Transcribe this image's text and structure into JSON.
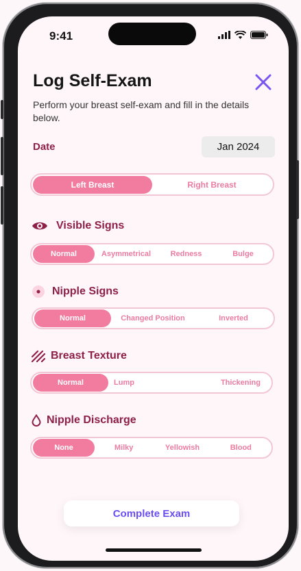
{
  "status": {
    "time": "9:41"
  },
  "header": {
    "title": "Log Self-Exam",
    "subtitle": "Perform your breast self-exam and fill in the details below.",
    "close_icon": "x-icon",
    "accent_color": "#7a55f0"
  },
  "date": {
    "label": "Date",
    "value": "Jan 2024"
  },
  "side_toggle": {
    "options": [
      "Left Breast",
      "Right Breast"
    ],
    "selected": "Left Breast"
  },
  "sections": [
    {
      "key": "visible-signs",
      "title": "Visible Signs",
      "icon": "eye-icon",
      "options": [
        "Normal",
        "Asymmetrical",
        "Redness",
        "Bulge"
      ],
      "selected": "Normal"
    },
    {
      "key": "nipple-signs",
      "title": "Nipple Signs",
      "icon": "dot-circle-icon",
      "options": [
        "Normal",
        "Changed Position",
        "Inverted"
      ],
      "selected": "Normal"
    },
    {
      "key": "breast-texture",
      "title": "Breast Texture",
      "icon": "texture-lines-icon",
      "options": [
        "Normal",
        "Lump",
        "Thickening"
      ],
      "selected": "Normal"
    },
    {
      "key": "nipple-discharge",
      "title": "Nipple Discharge",
      "icon": "droplet-icon",
      "options": [
        "None",
        "Milky",
        "Yellowish",
        "Blood"
      ],
      "selected": "None"
    }
  ],
  "footer": {
    "complete_label": "Complete Exam"
  },
  "colors": {
    "primary": "#f27c9f",
    "heading": "#8e1f47",
    "cta": "#6b4ef0"
  }
}
